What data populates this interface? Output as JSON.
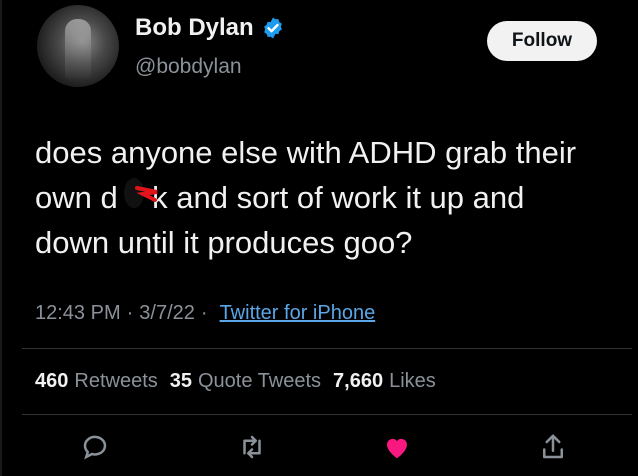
{
  "user": {
    "name": "Bob Dylan",
    "handle": "@bobdylan",
    "verified": true,
    "verified_color": "#1d9bf0"
  },
  "follow_button": {
    "label": "Follow"
  },
  "tweet": {
    "text": "does anyone else with ADHD grab their\nown d    k and sort of work it up and\ndown until it produces goo?",
    "redaction_color": "#e0141a"
  },
  "meta": {
    "time": "12:43 PM",
    "date": "3/7/22",
    "separator": "·",
    "source": "Twitter for iPhone"
  },
  "stats": {
    "retweets_count": "460",
    "retweets_label": "Retweets",
    "quotes_count": "35",
    "quotes_label": "Quote Tweets",
    "likes_count": "7,660",
    "likes_label": "Likes"
  },
  "actions": {
    "reply_icon": "reply-icon",
    "retweet_icon": "retweet-icon",
    "like_icon": "heart-icon",
    "like_color": "#f91880",
    "share_icon": "share-icon"
  }
}
